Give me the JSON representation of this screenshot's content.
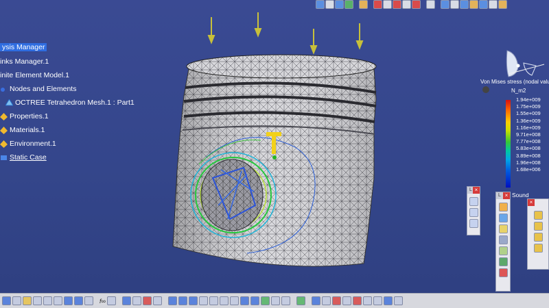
{
  "tree": {
    "items": [
      {
        "label": "ysis Manager",
        "icon": "analysis-manager-icon",
        "selected": true
      },
      {
        "label": "inks Manager.1",
        "icon": "links-manager-icon"
      },
      {
        "label": "inite Element Model.1",
        "icon": "finite-element-model-icon"
      },
      {
        "label": "Nodes and Elements",
        "icon": "nodes-elements-icon"
      },
      {
        "label": "OCTREE Tetrahedron Mesh.1 : Part1",
        "icon": "mesh-icon"
      },
      {
        "label": "Properties.1",
        "icon": "properties-icon"
      },
      {
        "label": "Materials.1",
        "icon": "materials-icon"
      },
      {
        "label": "Environment.1",
        "icon": "environment-icon"
      },
      {
        "label": "Static Case",
        "icon": "static-case-icon",
        "link": true
      }
    ]
  },
  "legend": {
    "title": "Von Mises stress (nodal value",
    "unit": "N_m2",
    "values": [
      "1.94e+009",
      "1.75e+009",
      "1.55e+009",
      "1.36e+009",
      "1.16e+009",
      "9.71e+008",
      "7.77e+008",
      "5.83e+008",
      "3.89e+008",
      "1.96e+008",
      "1.68e+006"
    ]
  },
  "floating": {
    "sound_label": "Sound"
  },
  "bottom_toolbar": {
    "formula_label": "f∞"
  },
  "colors": {
    "background_top": "#3a4a93",
    "selection": "#2f6de0",
    "mesh_fill": "#d4d4d8",
    "load_arrow": "#c8c03a",
    "restraint": "#f2d11a"
  }
}
